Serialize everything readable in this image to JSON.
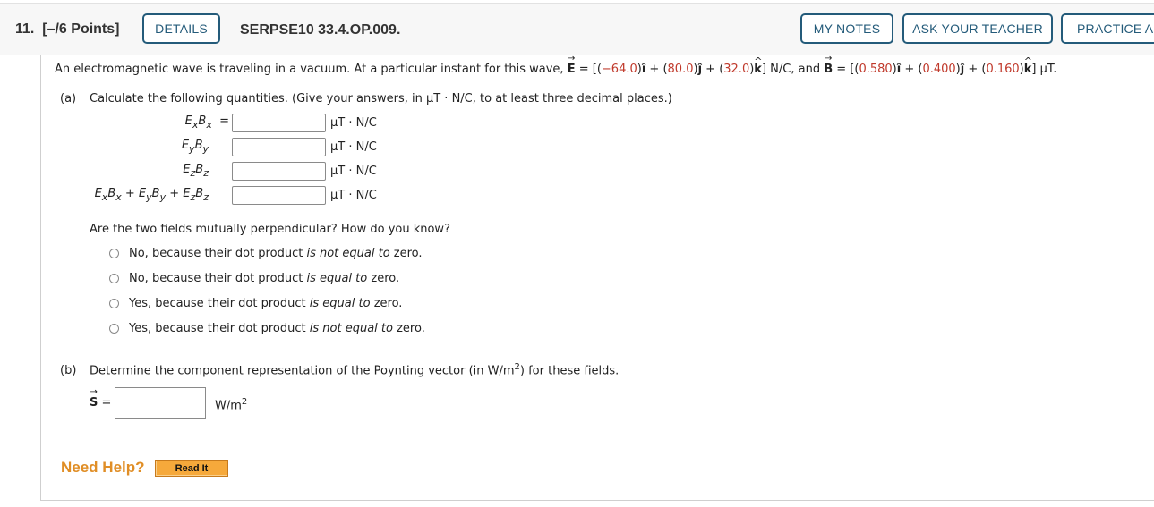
{
  "header": {
    "question_number": "11.",
    "points": "[–/6 Points]",
    "details_label": "DETAILS",
    "question_id": "SERPSE10 33.4.OP.009.",
    "my_notes_label": "MY NOTES",
    "ask_teacher_label": "ASK YOUR TEACHER",
    "practice_label": "PRACTICE ANOTHER"
  },
  "statement": {
    "intro": "An electromagnetic wave is traveling in a vacuum. At a particular instant for this wave, ",
    "E_symbol": "E",
    "E_components": [
      "−64.0",
      "80.0",
      "32.0"
    ],
    "E_unit": "N/C",
    "connector": ", and ",
    "B_symbol": "B",
    "B_components": [
      "0.580",
      "0.400",
      "0.160"
    ],
    "B_unit": "μT."
  },
  "part_a": {
    "label": "(a)",
    "instruction": "Calculate the following quantities. (Give your answers, in μT · N/C, to at least three decimal places.)",
    "rows": [
      {
        "label": "ExBx",
        "value": "",
        "unit": "μT · N/C"
      },
      {
        "label": "EyBy",
        "value": "",
        "unit": "μT · N/C"
      },
      {
        "label": "EzBz",
        "value": "",
        "unit": "μT · N/C"
      },
      {
        "label": "ExBx + EyBy + EzBz",
        "value": "",
        "unit": "μT · N/C"
      }
    ],
    "question": "Are the two fields mutually perpendicular? How do you know?",
    "options": [
      {
        "prefix": "No, because their dot product ",
        "emph": "is not equal to",
        "suffix": " zero.",
        "selected": false
      },
      {
        "prefix": "No, because their dot product ",
        "emph": "is equal to",
        "suffix": " zero.",
        "selected": false
      },
      {
        "prefix": "Yes, because their dot product ",
        "emph": "is equal to",
        "suffix": " zero.",
        "selected": false
      },
      {
        "prefix": "Yes, because their dot product ",
        "emph": "is not equal to",
        "suffix": " zero.",
        "selected": false
      }
    ]
  },
  "part_b": {
    "label": "(b)",
    "instruction_pre": "Determine the component representation of the Poynting vector (in W/m",
    "instruction_sup": "2",
    "instruction_post": ") for these fields.",
    "S_symbol": "S",
    "equals": "=",
    "value": "",
    "unit": "W/m",
    "unit_sup": "2"
  },
  "help": {
    "need_help_label": "Need Help?",
    "read_it_label": "Read It"
  }
}
